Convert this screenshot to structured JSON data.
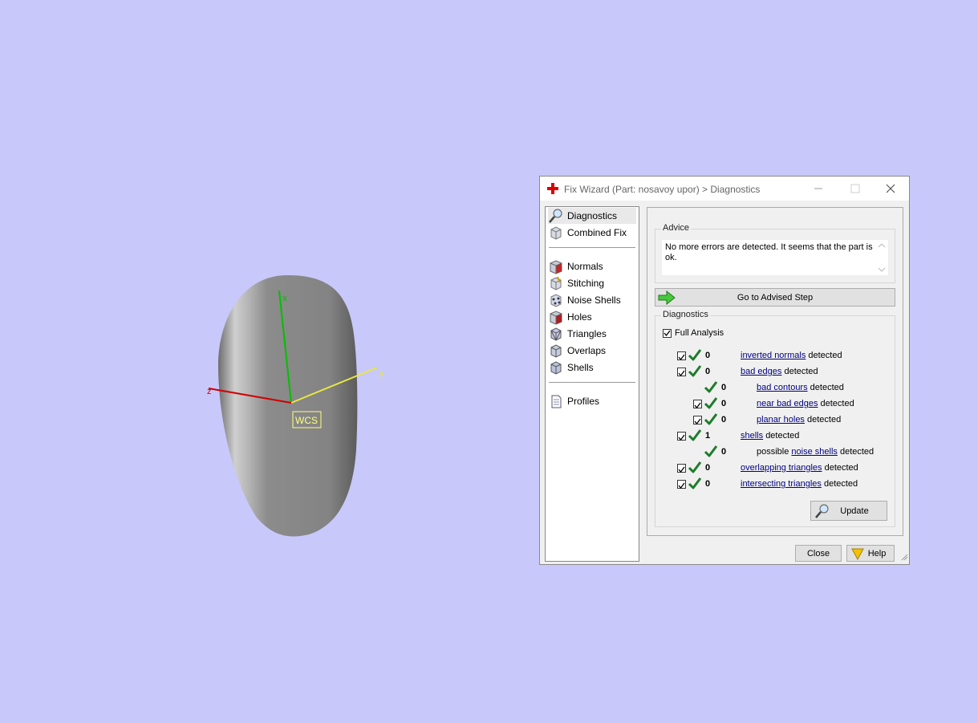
{
  "viewport": {
    "wcs_label": "WCS",
    "axis_x_label": "x",
    "axis_y_label": "y",
    "axis_z_label": "z",
    "colors": {
      "background": "#c8c8fb",
      "axis_x": "#00c000",
      "axis_y": "#e8e840",
      "axis_z": "#d00000",
      "wcs": "#ffff80"
    }
  },
  "dialog": {
    "title": "Fix Wizard (Part: nosavoy upor) > Diagnostics",
    "app_icon": "red-cross-icon",
    "nav": {
      "items": [
        {
          "label": "Diagnostics",
          "icon": "magnifier-icon",
          "selected": true
        },
        {
          "label": "Combined Fix",
          "icon": "cube-icon"
        },
        {
          "label": "Normals",
          "icon": "cube-red-face-icon"
        },
        {
          "label": "Stitching",
          "icon": "cube-stitch-icon"
        },
        {
          "label": "Noise Shells",
          "icon": "cube-dots-icon"
        },
        {
          "label": "Holes",
          "icon": "cube-hole-icon"
        },
        {
          "label": "Triangles",
          "icon": "cube-triangles-icon"
        },
        {
          "label": "Overlaps",
          "icon": "cube-overlap-icon"
        },
        {
          "label": "Shells",
          "icon": "cube-shell-icon"
        },
        {
          "label": "Profiles",
          "icon": "document-icon"
        }
      ]
    },
    "advice": {
      "group_label": "Advice",
      "text": "No more errors are detected. It seems that the part is ok."
    },
    "advised_step_button": "Go to Advised Step",
    "diagnostics": {
      "group_label": "Diagnostics",
      "full_analysis_label": "Full Analysis",
      "full_analysis_checked": true,
      "rows": {
        "inverted_normals": {
          "count": "0",
          "link": "inverted normals",
          "suffix": "detected"
        },
        "bad_edges": {
          "count": "0",
          "link": "bad edges",
          "suffix": "detected"
        },
        "bad_contours": {
          "count": "0",
          "link": "bad contours",
          "suffix": "detected"
        },
        "near_bad_edges": {
          "count": "0",
          "link": "near bad edges",
          "suffix": "detected"
        },
        "planar_holes": {
          "count": "0",
          "link": "planar holes",
          "suffix": "detected"
        },
        "shells": {
          "count": "1",
          "link": "shells",
          "suffix": "detected"
        },
        "noise_shells": {
          "count": "0",
          "prefix": "possible",
          "link": "noise shells",
          "suffix": "detected"
        },
        "overlapping_triangles": {
          "count": "0",
          "link": "overlapping triangles",
          "suffix": "detected"
        },
        "intersecting_triangles": {
          "count": "0",
          "link": "intersecting triangles",
          "suffix": "detected"
        }
      },
      "update_button": "Update"
    },
    "close_button": "Close",
    "help_button": "Help"
  }
}
